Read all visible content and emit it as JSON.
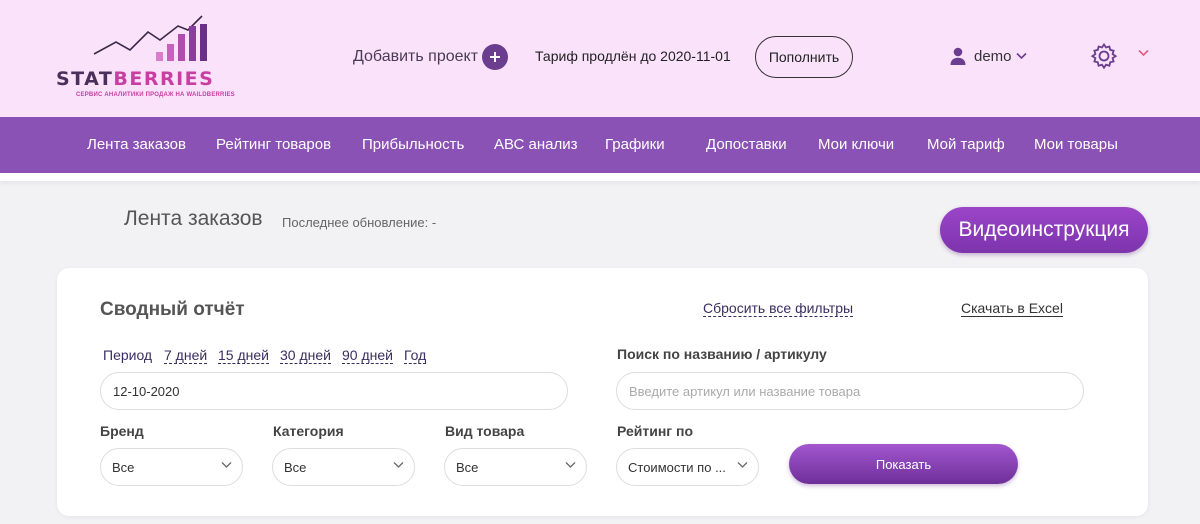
{
  "header": {
    "logo": {
      "brand_part1": "STAT",
      "brand_part2": "BERRIES",
      "tagline": "СЕРВИС АНАЛИТИКИ ПРОДАЖ НА WAILDBERRIES",
      "icon": "chart-growth-logo-icon"
    },
    "add_project_label": "Добавить проект",
    "add_project_icon": "plus-circle-icon",
    "tariff_text": "Тариф продлён до 2020-11-01",
    "topup_label": "Пополнить",
    "user_name": "demo",
    "user_icon": "user-icon",
    "user_chevron_icon": "chevron-down-icon",
    "settings_icon": "gear-icon",
    "settings_caret_icon": "caret-down-icon"
  },
  "nav": {
    "items": [
      {
        "label": "Лента заказов"
      },
      {
        "label": "Рейтинг товаров"
      },
      {
        "label": "Прибыльность"
      },
      {
        "label": "АВС анализ"
      },
      {
        "label": "Графики"
      },
      {
        "label": "Допоставки"
      },
      {
        "label": "Мои ключи"
      },
      {
        "label": "Мой тариф"
      },
      {
        "label": "Мои товары"
      }
    ]
  },
  "page": {
    "title": "Лента заказов",
    "last_update": "Последнее обновление: -",
    "video_button": "Видеоинструкция"
  },
  "report": {
    "title": "Сводный отчёт",
    "reset_filters": "Сбросить все фильтры",
    "download_excel": "Скачать в Excel",
    "period": {
      "label": "Период",
      "options": [
        "7 дней",
        "15 дней",
        "30 дней",
        "90 дней",
        "Год"
      ]
    },
    "date_value": "12-10-2020",
    "search": {
      "label": "Поиск по названию / артикулу",
      "placeholder": "Введите артикул или название товара"
    },
    "filters": {
      "brand": {
        "label": "Бренд",
        "value": "Все"
      },
      "category": {
        "label": "Категория",
        "value": "Все"
      },
      "product_type": {
        "label": "Вид товара",
        "value": "Все"
      },
      "rating_by": {
        "label": "Рейтинг по",
        "value": "Стоимости по ..."
      }
    },
    "show_button": "Показать"
  },
  "colors": {
    "header_bg": "#fbe2fb",
    "nav_bg": "#8b52b5",
    "accent": "#7c34ac",
    "brand_pink": "#c63fa1"
  }
}
